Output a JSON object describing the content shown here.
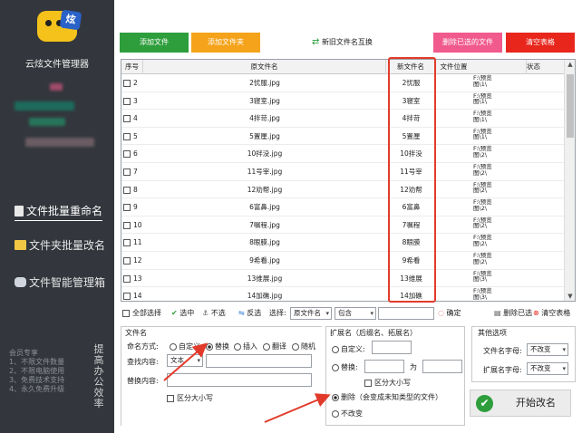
{
  "app": {
    "title": "云炫文件管理器",
    "logo_text": "炫"
  },
  "nav": [
    {
      "label": "文件批量重命名",
      "active": true
    },
    {
      "label": "文件夹批量改名",
      "active": false
    },
    {
      "label": "文件智能管理箱",
      "active": false
    }
  ],
  "member": {
    "title": "会员专享",
    "lines": [
      "1、不限文件数量",
      "2、不限电脑使用",
      "3、免费技术支持",
      "4、永久免费升级"
    ]
  },
  "efficiency": "提高办公效率",
  "toolbar": {
    "add_file": "添加文件",
    "add_folder": "添加文件夹",
    "swap": "新旧文件名互换",
    "delete_selected": "删除已选的文件",
    "clear_table": "清空表格",
    "colors": {
      "add_file": "#2e9e3c",
      "add_folder": "#f5a31a",
      "delete_selected": "#f15a8c",
      "clear_table": "#e8261c"
    }
  },
  "table": {
    "columns": [
      "序号",
      "原文件名",
      "新文件名",
      "文件位置",
      "状态"
    ],
    "rows": [
      {
        "seq": "2",
        "orig": "2忧服.jpg",
        "new": "2忧服",
        "loc": [
          "F:\\预览",
          "图\\1\\"
        ]
      },
      {
        "seq": "3",
        "orig": "3寝室.jpg",
        "new": "3寝室",
        "loc": [
          "F:\\预览",
          "图\\1\\"
        ]
      },
      {
        "seq": "4",
        "orig": "4拌苛.jpg",
        "new": "4拌苛",
        "loc": [
          "F:\\预览",
          "图\\1\\"
        ]
      },
      {
        "seq": "5",
        "orig": "5置厘.jpg",
        "new": "5置厘",
        "loc": [
          "F:\\预览",
          "图\\1\\"
        ]
      },
      {
        "seq": "6",
        "orig": "10拌没.jpg",
        "new": "10拌没",
        "loc": [
          "F:\\预览",
          "图\\2\\"
        ]
      },
      {
        "seq": "7",
        "orig": "11号宰.jpg",
        "new": "11号宰",
        "loc": [
          "F:\\预览",
          "图\\2\\"
        ]
      },
      {
        "seq": "8",
        "orig": "12劝帮.jpg",
        "new": "12劝帮",
        "loc": [
          "F:\\预览",
          "图\\2\\"
        ]
      },
      {
        "seq": "9",
        "orig": "6富鼻.jpg",
        "new": "6富鼻",
        "loc": [
          "F:\\预览",
          "图\\2\\"
        ]
      },
      {
        "seq": "10",
        "orig": "7嘱程.jpg",
        "new": "7嘱程",
        "loc": [
          "F:\\预览",
          "图\\2\\"
        ]
      },
      {
        "seq": "11",
        "orig": "8眼膜.jpg",
        "new": "8眼膜",
        "loc": [
          "F:\\预览",
          "图\\2\\"
        ]
      },
      {
        "seq": "12",
        "orig": "9希看.jpg",
        "new": "9希看",
        "loc": [
          "F:\\预览",
          "图\\2\\"
        ]
      },
      {
        "seq": "13",
        "orig": "13维展.jpg",
        "new": "13维展",
        "loc": [
          "F:\\预览",
          "图\\3\\"
        ]
      },
      {
        "seq": "14",
        "orig": "14加礁.jpg",
        "new": "14加礁",
        "loc": [
          "F:\\预览",
          "图\\3\\"
        ]
      }
    ]
  },
  "selectbar": {
    "select_all": "全部选择",
    "select_btn": "选中",
    "unselect_btn": "不选",
    "invert_btn": "反选",
    "select_label": "选择:",
    "field_value": "原文件名",
    "op_value": "包含",
    "text_value": "",
    "confirm": "确定",
    "delete_selected": "删除已选",
    "clear_table": "清空表格"
  },
  "filename_section": {
    "title": "文件名",
    "mode_label": "命名方式:",
    "modes": [
      {
        "label": "自定义",
        "checked": false
      },
      {
        "label": "替换",
        "checked": true
      },
      {
        "label": "插入",
        "checked": false
      },
      {
        "label": "翻译",
        "checked": false
      },
      {
        "label": "随机",
        "checked": false
      }
    ],
    "find_label": "查找内容:",
    "find_mode": "文本",
    "find_value": "",
    "replace_label": "替换内容:",
    "replace_value": "",
    "case_label": "区分大小写"
  },
  "ext_section": {
    "title": "扩展名（后缀名、拓展名）",
    "custom": "自定义:",
    "replace": "替换:",
    "to": "为",
    "case_label": "区分大小写",
    "delete": "删除（会变成未知类型的文件）",
    "unchanged": "不改变",
    "selected": "删除"
  },
  "other_section": {
    "title": "其他选项",
    "fn_case_label": "文件名字母:",
    "fn_case_value": "不改变",
    "ext_case_label": "扩展名字母:",
    "ext_case_value": "不改变"
  },
  "start": "开始改名"
}
